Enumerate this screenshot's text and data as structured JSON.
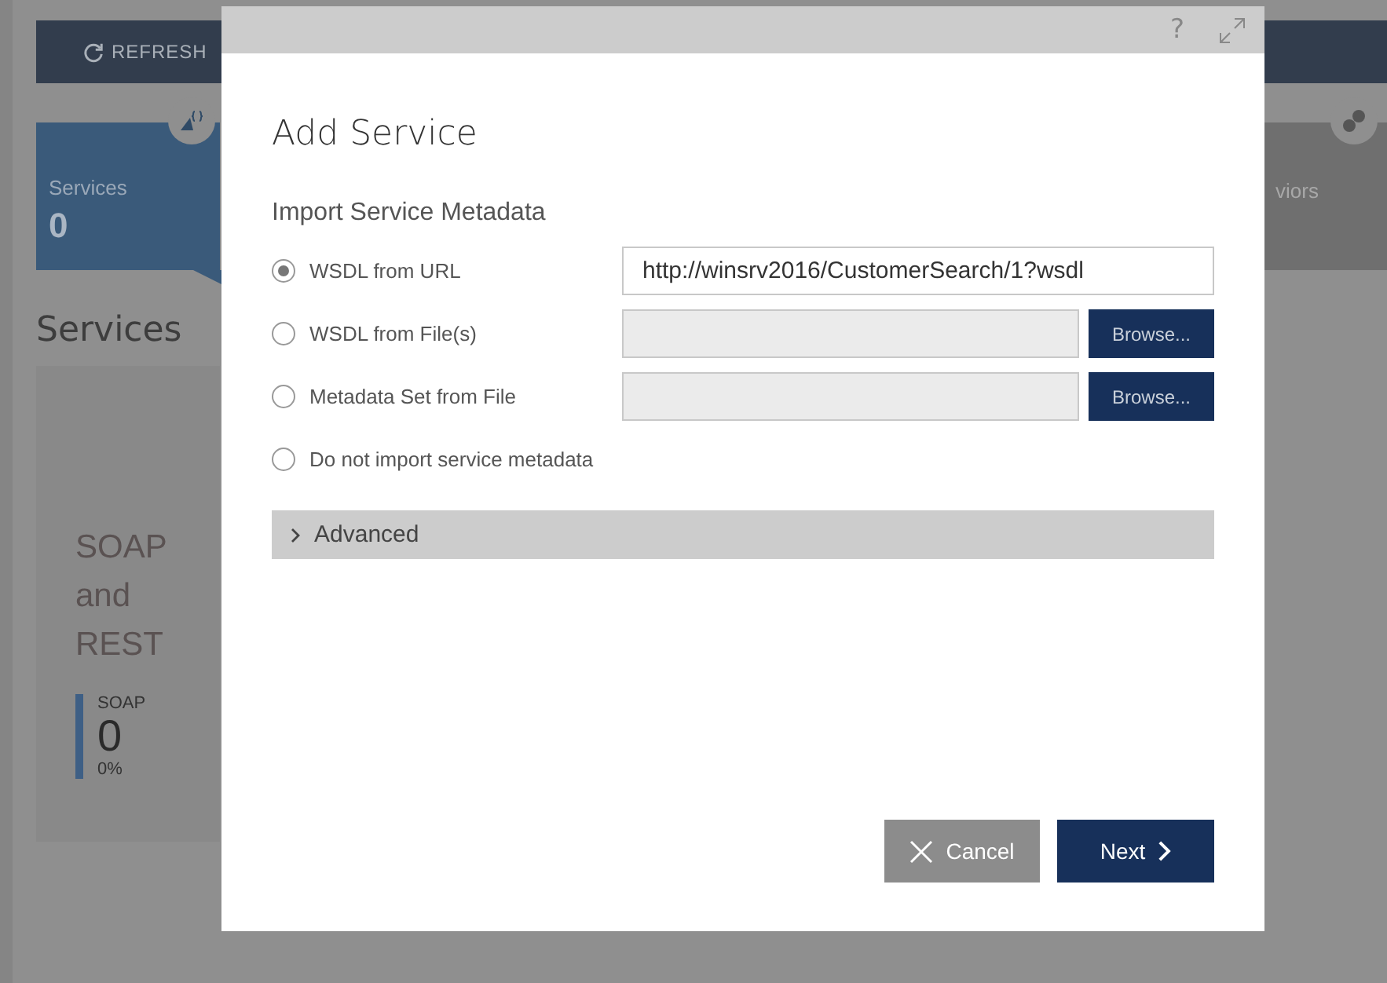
{
  "toolbar": {
    "refresh_label": "REFRESH"
  },
  "tiles": [
    {
      "kind": "services",
      "label": "Services",
      "count": "0"
    },
    {
      "kind": "behaviors",
      "label": "viors"
    }
  ],
  "section_title": "Services",
  "card": {
    "title": "SOAP and REST",
    "stat": {
      "label": "SOAP",
      "count": "0",
      "percent": "0%"
    }
  },
  "dialog": {
    "help": "?",
    "title": "Add Service",
    "section": "Import Service Metadata",
    "options": [
      {
        "kind": "url",
        "label": "WSDL from URL",
        "selected": true,
        "value": "http://winsrv2016/CustomerSearch/1?wsdl"
      },
      {
        "kind": "file",
        "label": "WSDL from File(s)",
        "selected": false,
        "button": "Browse..."
      },
      {
        "kind": "file",
        "label": "Metadata Set from File",
        "selected": false,
        "button": "Browse..."
      },
      {
        "kind": "none",
        "label": "Do not import service metadata",
        "selected": false
      }
    ],
    "advanced": {
      "label": "Advanced",
      "expanded": false
    },
    "buttons": [
      {
        "kind": "cancel",
        "label": "Cancel"
      },
      {
        "kind": "next",
        "label": "Next"
      }
    ]
  }
}
